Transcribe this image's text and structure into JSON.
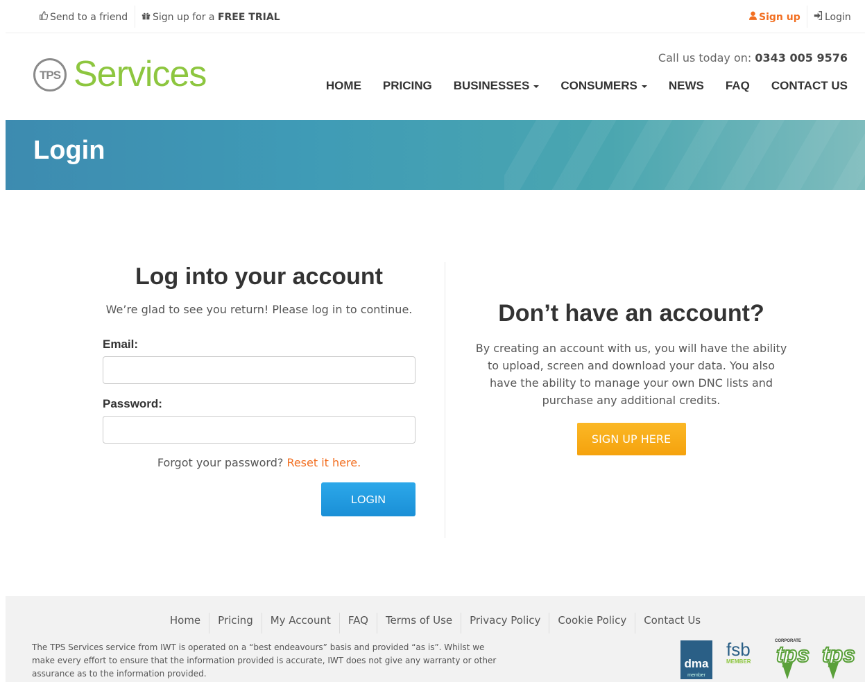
{
  "topbar": {
    "send_friend": "Send to a friend",
    "trial_prefix": "Sign up for a ",
    "trial_bold": "FREE TRIAL",
    "signup": "Sign up",
    "login": "Login"
  },
  "header": {
    "logo_mark": "TPS",
    "logo_text": "Services",
    "call_prefix": "Call us today on: ",
    "call_number": "0343 005 9576",
    "nav": {
      "home": "HOME",
      "pricing": "PRICING",
      "businesses": "BUSINESSES",
      "consumers": "CONSUMERS",
      "news": "NEWS",
      "faq": "FAQ",
      "contact": "CONTACT US"
    }
  },
  "banner": {
    "title": "Login"
  },
  "login": {
    "heading": "Log into your account",
    "subtitle": "We’re glad to see you return! Please log in to continue.",
    "email_label": "Email:",
    "email_value": "",
    "password_label": "Password:",
    "password_value": "",
    "forgot_prefix": "Forgot your password? ",
    "forgot_link": "Reset it here.",
    "button": "LOGIN"
  },
  "signup": {
    "heading": "Don’t have an account?",
    "description": "By creating an account with us, you will have the ability to upload, screen and download your data. You also have the ability to manage your own DNC lists and purchase any additional credits.",
    "button": "SIGN UP HERE"
  },
  "footer": {
    "links": {
      "home": "Home",
      "pricing": "Pricing",
      "my_account": "My Account",
      "faq": "FAQ",
      "terms": "Terms of Use",
      "privacy": "Privacy Policy",
      "cookie": "Cookie Policy",
      "contact": "Contact Us"
    },
    "disclaimer": "The TPS Services service from IWT is operated on a “best endeavours” basis and provided “as is”. Whilst we make every effort to ensure that the information provided is accurate, IWT does not give any warranty or other assurance as to the information provided.",
    "badges": {
      "dma": "dma",
      "dma_sub": "member",
      "fsb": "fsb",
      "fsb_sub": "MEMBER",
      "tps1": "tps",
      "tps1_cap": "CORPORATE",
      "tps2": "tps"
    }
  },
  "colors": {
    "accent_orange": "#f26f21",
    "brand_green": "#8dc63f",
    "login_button": "#1a8fd6",
    "signup_button": "#f5a20d",
    "banner": "#3f9bb6"
  },
  "icons": {
    "send_friend": "thumbs-up-icon",
    "trial": "gift-icon",
    "signup": "user-icon",
    "login": "sign-in-icon"
  }
}
